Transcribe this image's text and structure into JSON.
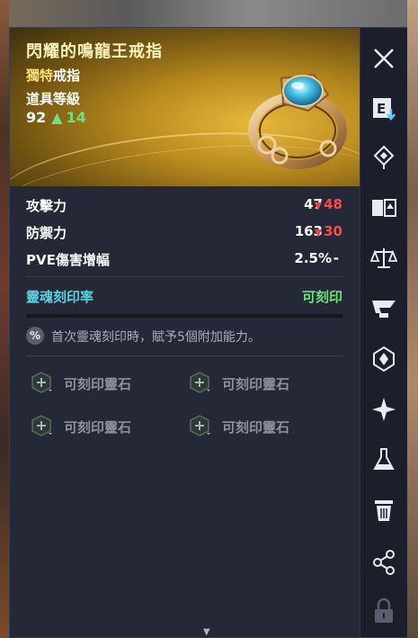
{
  "item": {
    "name": "閃耀的鳴龍王戒指",
    "grade_prefix": "獨特",
    "grade_type": "戒指",
    "level_label": "道具等級",
    "level": "92",
    "level_up": "14"
  },
  "stats": [
    {
      "label": "攻擊力",
      "value": "47",
      "diff": "48"
    },
    {
      "label": "防禦力",
      "value": "163",
      "diff": "30"
    },
    {
      "label": "PVE傷害增幅",
      "value": "2.5%",
      "diff": "-"
    }
  ],
  "soul": {
    "label": "靈魂刻印率",
    "status": "可刻印"
  },
  "notice": {
    "icon": "percent-icon",
    "text": "首次靈魂刻印時，賦予5個附加能力。"
  },
  "slots": [
    {
      "label": "可刻印靈石"
    },
    {
      "label": "可刻印靈石"
    },
    {
      "label": "可刻印靈石"
    },
    {
      "label": "可刻印靈石"
    }
  ],
  "sidebar": [
    {
      "icon": "close-icon"
    },
    {
      "icon": "equip-icon"
    },
    {
      "icon": "upgrade-icon"
    },
    {
      "icon": "compare-icon"
    },
    {
      "icon": "scale-icon"
    },
    {
      "icon": "anvil-icon"
    },
    {
      "icon": "soul-icon"
    },
    {
      "icon": "sparkle-icon"
    },
    {
      "icon": "flask-icon"
    },
    {
      "icon": "trash-icon"
    },
    {
      "icon": "share-icon"
    },
    {
      "icon": "lock-icon"
    }
  ],
  "colors": {
    "accent_gold": "#e8b93a",
    "stat_down": "#ff4a4a",
    "stat_up": "#6fe07a",
    "soul_label": "#5fd0e0",
    "panel_bg": "#252836"
  }
}
